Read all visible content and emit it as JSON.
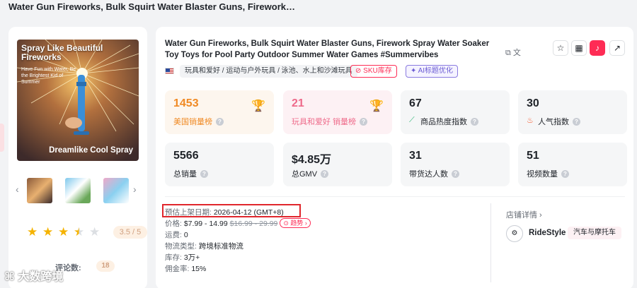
{
  "header": {
    "title": "Water Gun Fireworks, Bulk Squirt Water Blaster Guns, Firework…"
  },
  "side_tab": {
    "label": "品"
  },
  "product_image": {
    "headline": "Spray Like Beautiful Fireworks",
    "subline": "Have Fun with Water, Be the Brightest Kid of Summer",
    "bottom_text": "Dreamlike Cool Spray"
  },
  "thumbnails": {
    "prev_icon": "chevron-left-icon",
    "next_icon": "chevron-right-icon",
    "count": 3
  },
  "rating": {
    "value": 3.5,
    "max": 5,
    "score_text": "3.5 / 5",
    "review_label": "评论数:",
    "review_count": "18"
  },
  "watermark": {
    "text": "大数跨境"
  },
  "product": {
    "title": "Water Gun Fireworks, Bulk Squirt Water Blaster Guns, Firework Spray Water Soaker Toy Toys for Pool Party Outdoor Summer Water Games #Summervibes",
    "category": "玩具和爱好 / 运动与户外玩具 / 泳池、水上和沙滩玩具",
    "sku_tag": "SKU库存",
    "ai_tag": "AI标题优化",
    "copy_icons": "⧉ 文",
    "actions": [
      "star-icon",
      "qr-code-icon",
      "tiktok-icon",
      "external-link-icon"
    ]
  },
  "stats": [
    {
      "value": "1453",
      "label": "美国销量榜",
      "style": "orange",
      "icon": "trophy-icon"
    },
    {
      "value": "21",
      "label": "玩具和爱好 销量榜",
      "style": "pink",
      "icon": "trophy-icon"
    },
    {
      "value": "67",
      "label": "商品热度指数",
      "style": "plain",
      "icon": "trend-icon"
    },
    {
      "value": "30",
      "label": "人气指数",
      "style": "plain",
      "icon": "fire-icon"
    },
    {
      "value": "5566",
      "label": "总销量",
      "style": "plain"
    },
    {
      "value": "$4.85万",
      "label": "总GMV",
      "style": "plain"
    },
    {
      "value": "31",
      "label": "带货达人数",
      "style": "plain"
    },
    {
      "value": "51",
      "label": "视频数量",
      "style": "plain"
    }
  ],
  "details": {
    "launch_label": "预估上架日期:",
    "launch_value": "2026-04-12 (GMT+8)",
    "price_label": "价格:",
    "price_value": "$7.99 - 14.99",
    "price_original": "$16.99 - 29.99",
    "trend_label": "趋势",
    "shipping_label": "运费:",
    "shipping_value": "0",
    "logistics_label": "物流类型:",
    "logistics_value": "跨境标准物流",
    "stock_label": "库存:",
    "stock_value": "3万+",
    "commission_label": "佣金率:",
    "commission_value": "15%"
  },
  "shop": {
    "label": "店铺详情",
    "name": "RideStyle",
    "category": "汽车与摩托车"
  },
  "colors": {
    "brand": "#fe2c55",
    "orange": "#f08a24",
    "pink": "#ee6a8a",
    "highlight": "#e0262c"
  }
}
